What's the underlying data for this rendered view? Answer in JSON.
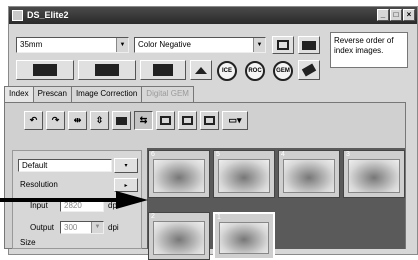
{
  "window": {
    "title": "DS_Elite2",
    "controls": [
      "_",
      "□",
      "×"
    ]
  },
  "toolbar": {
    "film_format": "35mm",
    "film_type": "Color Negative",
    "buttons": {
      "ice": "ICE",
      "roc": "ROC",
      "gem": "GEM"
    },
    "icons": [
      "film-strip-icon",
      "film-frames-icon",
      "film-slide-icon",
      "eject-icon",
      "ice-icon",
      "roc-icon",
      "gem-icon",
      "eraser-icon",
      "save-settings-icon",
      "scan-icon"
    ]
  },
  "reverse_note": "Reverse order of index images.",
  "tabs": [
    {
      "label": "Index",
      "active": true,
      "disabled": false
    },
    {
      "label": "Prescan",
      "active": false,
      "disabled": false
    },
    {
      "label": "Image Correction",
      "active": false,
      "disabled": false
    },
    {
      "label": "Digital GEM",
      "active": false,
      "disabled": true
    }
  ],
  "tools": [
    "rotate-left-icon",
    "rotate-right-icon",
    "flip-horizontal-icon",
    "flip-vertical-icon",
    "select-all-icon",
    "reverse-order-icon",
    "settings-1-icon",
    "settings-2-icon",
    "settings-3-icon",
    "view-menu-icon"
  ],
  "settings": {
    "preset": "Default",
    "resolution_label": "Resolution",
    "input_label": "Input",
    "input_value": "2820",
    "output_label": "Output",
    "output_value": "300",
    "unit": "dpi",
    "size_label": "Size"
  },
  "thumbnails": [
    {
      "number": "6",
      "selected": false
    },
    {
      "number": "5",
      "selected": false
    },
    {
      "number": "4",
      "selected": false
    },
    {
      "number": "3",
      "selected": false
    },
    {
      "number": "2",
      "selected": false
    },
    {
      "number": "1",
      "selected": true
    }
  ]
}
